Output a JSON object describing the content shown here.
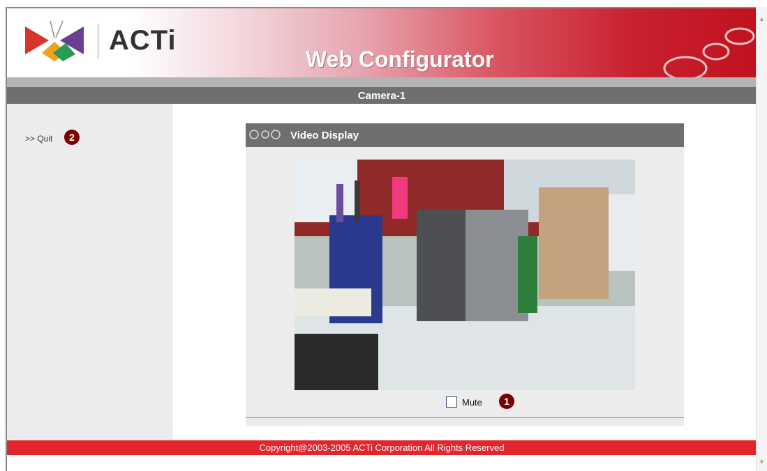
{
  "header": {
    "logo_text": "ACTi",
    "app_title": "Web Configurator"
  },
  "camera": {
    "name": "Camera-1"
  },
  "sidebar": {
    "quit_label": ">> Quit",
    "quit_callout": "2"
  },
  "video_display": {
    "title": "Video Display",
    "mute_label": "Mute",
    "mute_checked": false,
    "mute_callout": "1"
  },
  "footer": {
    "copyright": "Copyright@2003-2005 ACTi Corporation All Rights Reserved"
  },
  "colors": {
    "brand_red": "#c1121f",
    "bar_gray": "#6f6f6f",
    "callout": "#7a0000"
  },
  "icons": [
    "acti-logo-icon",
    "rings-decoration-icon",
    "panel-rings-icon",
    "scroll-up-arrow-icon",
    "scroll-down-arrow-icon"
  ]
}
